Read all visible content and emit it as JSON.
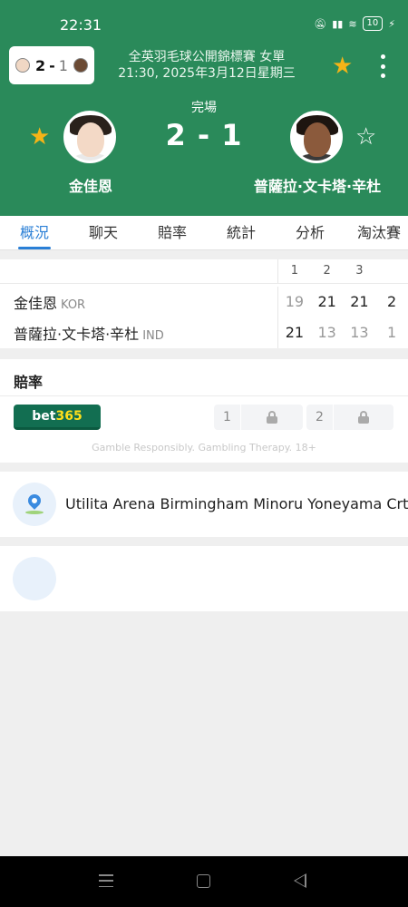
{
  "status_bar": {
    "time": "22:31",
    "battery": "10",
    "icons": [
      "mute-icon",
      "signal-icon",
      "wifi-icon",
      "battery-icon",
      "charging-icon"
    ]
  },
  "header": {
    "mini_score": {
      "home": "2",
      "separator": "-",
      "away": "1"
    },
    "competition": "全英羽毛球公開錦標賽 女單",
    "datetime": "21:30, 2025年3月12日星期三",
    "status": "完場",
    "score": "2 - 1",
    "home_name": "金佳恩",
    "away_name": "普薩拉·文卡塔·辛杜",
    "home_favorite": true,
    "away_favorite": false
  },
  "tabs": [
    {
      "label": "概況",
      "active": true
    },
    {
      "label": "聊天",
      "active": false
    },
    {
      "label": "賠率",
      "active": false
    },
    {
      "label": "統計",
      "active": false
    },
    {
      "label": "分析",
      "active": false
    },
    {
      "label": "淘汰賽",
      "active": false
    }
  ],
  "score_table": {
    "set_headers": [
      "1",
      "2",
      "3",
      ""
    ],
    "players": [
      {
        "name": "金佳恩",
        "country": "KOR",
        "scores": [
          "19",
          "21",
          "21",
          "2"
        ],
        "lost": [
          true,
          false,
          false,
          false
        ]
      },
      {
        "name": "普薩拉·文卡塔·辛杜",
        "country": "IND",
        "scores": [
          "21",
          "13",
          "13",
          "1"
        ],
        "lost": [
          false,
          true,
          true,
          true
        ]
      }
    ]
  },
  "odds": {
    "title": "賠率",
    "bookmaker": {
      "part1": "bet",
      "part2": "365"
    },
    "options": [
      {
        "label": "1"
      },
      {
        "label": "2"
      }
    ],
    "disclaimer": "Gamble Responsibly. Gambling Therapy. 18+"
  },
  "venue": {
    "name": "Utilita Arena Birmingham Minoru Yoneyama Crt"
  },
  "colors": {
    "header_bg": "#2a8a5a",
    "accent": "#2a7fd6",
    "star": "#f5b417",
    "bet365": "#126e51"
  }
}
